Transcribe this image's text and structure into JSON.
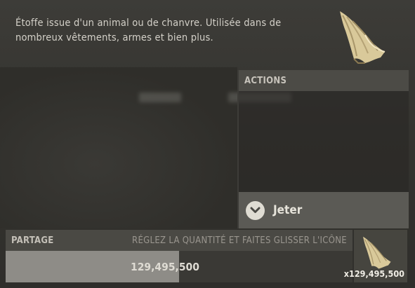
{
  "item": {
    "description": "Étoffe issue d'un animal ou de chanvre. Utilisée dans de nombreux vêtements, armes et bien plus.",
    "icon": "cloth-icon"
  },
  "actions": {
    "header": "ACTIONS",
    "buttons": [
      {
        "label": "Jeter",
        "icon": "chevron-down-icon"
      }
    ]
  },
  "share": {
    "title": "PARTAGE",
    "hint": "RÉGLEZ LA QUANTITÉ ET FAITES GLISSER L'ICÔNE",
    "amount": "129,495,500",
    "fill_fraction": 0.5
  },
  "slot": {
    "count": "x129,495,500",
    "icon": "cloth-icon"
  },
  "colors": {
    "accent": "#dfdcd3",
    "panel": "#4c4b46",
    "slider_fill": "#8e8c87"
  }
}
